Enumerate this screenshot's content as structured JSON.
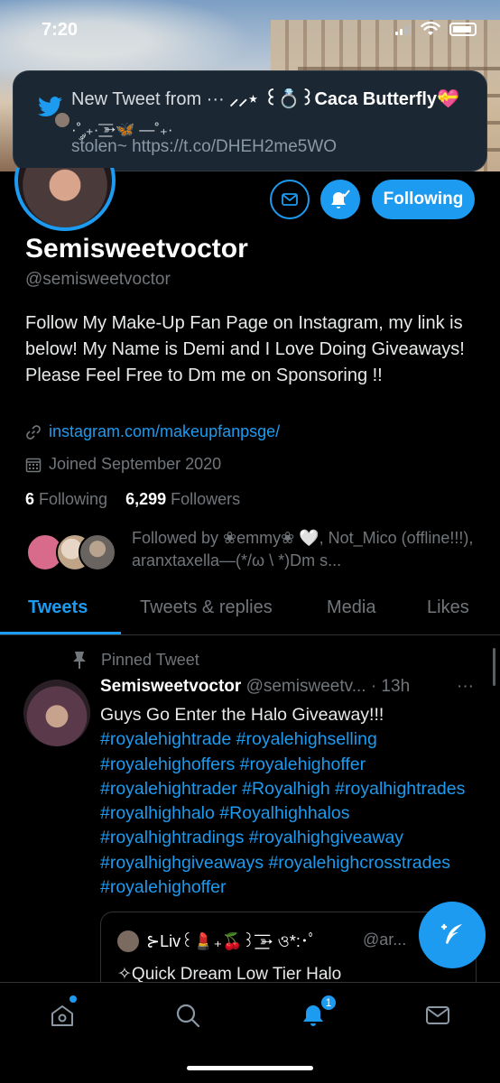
{
  "status_bar": {
    "time": "7:20"
  },
  "notification": {
    "title_prefix": "New Tweet from ···",
    "title_name": "⸝⸝⋆ ꒰💍꒱Caca Butterfly💝",
    "title_line2": "·˚ ༘₊· ͟͟͞͞➳🦋 —˚₊·",
    "body": "stolen~ https://t.co/DHEH2me5WO"
  },
  "profile": {
    "follow_button_label": "Following",
    "display_name": "Semisweetvoctor",
    "handle": "@semisweetvoctor",
    "bio": "Follow My Make-Up Fan Page on Instagram, my link is below! My Name is Demi and I Love Doing Giveaways! Please Feel Free to Dm me on Sponsoring !!",
    "link": "instagram.com/makeupfanpsge/",
    "joined": "Joined September 2020",
    "following_count": "6",
    "following_label": "Following",
    "followers_count": "6,299",
    "followers_label": "Followers",
    "followed_by": "Followed by ❀emmy❀ 🤍, Not_Mico (offline!!!), aranxtaxella—(*/ω \\ *)Dm s..."
  },
  "tabs": [
    {
      "label": "Tweets",
      "active": true
    },
    {
      "label": "Tweets & replies",
      "active": false
    },
    {
      "label": "Media",
      "active": false
    },
    {
      "label": "Likes",
      "active": false
    }
  ],
  "tweet": {
    "pinned_label": "Pinned Tweet",
    "author_name": "Semisweetvoctor",
    "author_handle": "@semisweetv...",
    "time": "· 13h",
    "more": "···",
    "text": "Guys Go Enter the Halo Giveaway!!!",
    "hashtags": "#royalehightrade #royalehighselling #royalehighoffers #royalehighoffer #royalehightrader #Royalhigh #royalhightrades #royalhighhalo #Royalhighhalos #royalhightradings #royalhighgiveaway #royalhighgiveaways #royalehighcrosstrades #royalehighoffer",
    "quote": {
      "name": "⊱Liv꒰💄₊🍒꒱ ͟͟͞͞➳ ও*:･ﾟ",
      "handle": "@ar...",
      "text": "✧Quick Dream Low Tier Halo"
    }
  },
  "bottom_nav": {
    "notifications_badge": "1"
  },
  "colors": {
    "accent": "#1d9bf0",
    "background": "#000000",
    "muted_text": "#71767b"
  }
}
